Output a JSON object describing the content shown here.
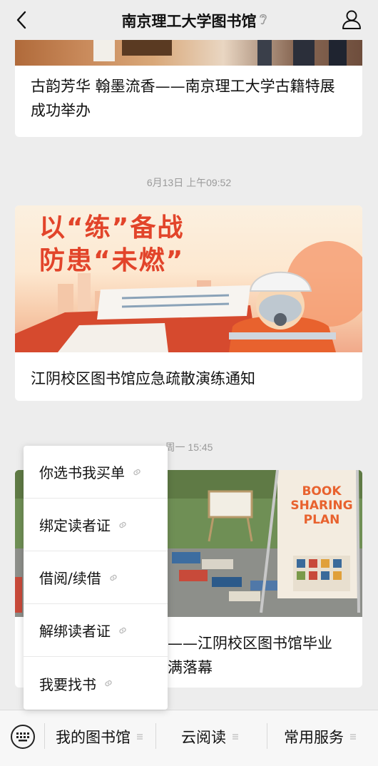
{
  "header": {
    "title": "南京理工大学图书馆"
  },
  "feed": [
    {
      "text": "古韵芳华 翰墨流香——南京理工大学古籍特展成功举办"
    },
    {
      "timestamp": "6月13日 上午09:52",
      "poster_lines": [
        "以“练”备战",
        "防患“未燃”"
      ],
      "text": "江阴校区图书馆应急疏散演练通知"
    },
    {
      "timestamp": "周一 15:45",
      "poster_text": [
        "BOOK",
        "SHARING",
        "PLAN"
      ],
      "text_line1": "——江阴校区图书馆毕业",
      "text_line2": "满落幕"
    }
  ],
  "popup_menu": {
    "items": [
      {
        "label": "你选书我买单"
      },
      {
        "label": "绑定读者证"
      },
      {
        "label": "借阅/续借"
      },
      {
        "label": "解绑读者证"
      },
      {
        "label": "我要找书"
      }
    ]
  },
  "bottom_bar": {
    "items": [
      {
        "label": "我的图书馆"
      },
      {
        "label": "云阅读"
      },
      {
        "label": "常用服务"
      }
    ]
  }
}
